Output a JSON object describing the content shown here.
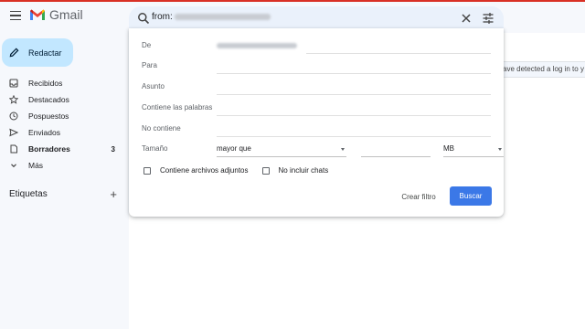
{
  "header": {
    "app_name": "Gmail",
    "search_prefix": "from:"
  },
  "sidebar": {
    "compose_label": "Redactar",
    "items": [
      {
        "label": "Recibidos",
        "icon": "inbox-icon",
        "count": ""
      },
      {
        "label": "Destacados",
        "icon": "star-icon",
        "count": ""
      },
      {
        "label": "Pospuestos",
        "icon": "clock-icon",
        "count": ""
      },
      {
        "label": "Enviados",
        "icon": "send-icon",
        "count": ""
      },
      {
        "label": "Borradores",
        "icon": "draft-icon",
        "count": "3"
      },
      {
        "label": "Más",
        "icon": "chevron-down-icon",
        "count": ""
      }
    ],
    "labels_title": "Etiquetas"
  },
  "notice_text": "ave detected a log in to y",
  "search_panel": {
    "from_label": "De",
    "to_label": "Para",
    "subject_label": "Asunto",
    "has_words_label": "Contiene las palabras",
    "no_words_label": "No contiene",
    "size_label": "Tamaño",
    "size_operator": "mayor que",
    "size_unit": "MB",
    "attachments_label": "Contiene archivos adjuntos",
    "no_chats_label": "No incluir chats",
    "create_filter_label": "Crear filtro",
    "search_button_label": "Buscar"
  },
  "colors": {
    "accent": "#3b78e7",
    "compose_bg": "#c2e7ff",
    "search_bg": "#eaf1fb",
    "sidebar_bg": "#f6f8fc"
  }
}
